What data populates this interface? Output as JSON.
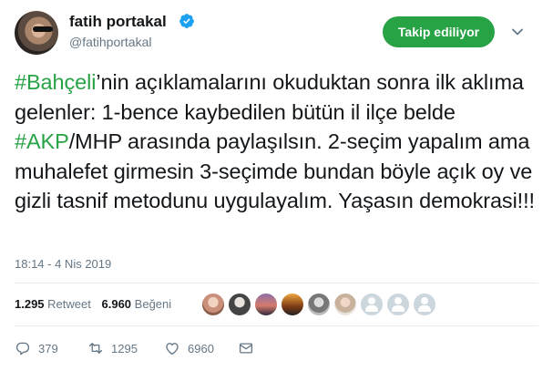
{
  "author": {
    "display_name": "fatih portakal",
    "handle": "@fatihportakal",
    "verified": true
  },
  "follow_button": {
    "label": "Takip ediliyor"
  },
  "tweet": {
    "segments": [
      {
        "text": "#Bahçeli",
        "hashtag": true
      },
      {
        "text": "’nin açıklamalarını okuduktan sonra ilk aklıma gelenler: 1-bence kaybedilen bütün il ilçe belde ",
        "hashtag": false
      },
      {
        "text": "#AKP",
        "hashtag": true
      },
      {
        "text": "/MHP arasında paylaşılsın. 2-seçim yapalım ama muhalefet girmesin 3-seçimde bundan böyle açık oy ve gizli tasnif metodunu uygulayalım. Yaşasın demokrasi!!!",
        "hashtag": false
      }
    ],
    "timestamp": "18:14 - 4 Nis 2019"
  },
  "stats": {
    "retweets_count": "1.295",
    "retweets_label": "Retweet",
    "likes_count": "6.960",
    "likes_label": "Beğeni"
  },
  "actions": {
    "reply_count": "379",
    "retweet_count": "1295",
    "like_count": "6960"
  },
  "colors": {
    "accent": "#27a346",
    "muted": "#657786",
    "verified": "#1da1f2"
  }
}
